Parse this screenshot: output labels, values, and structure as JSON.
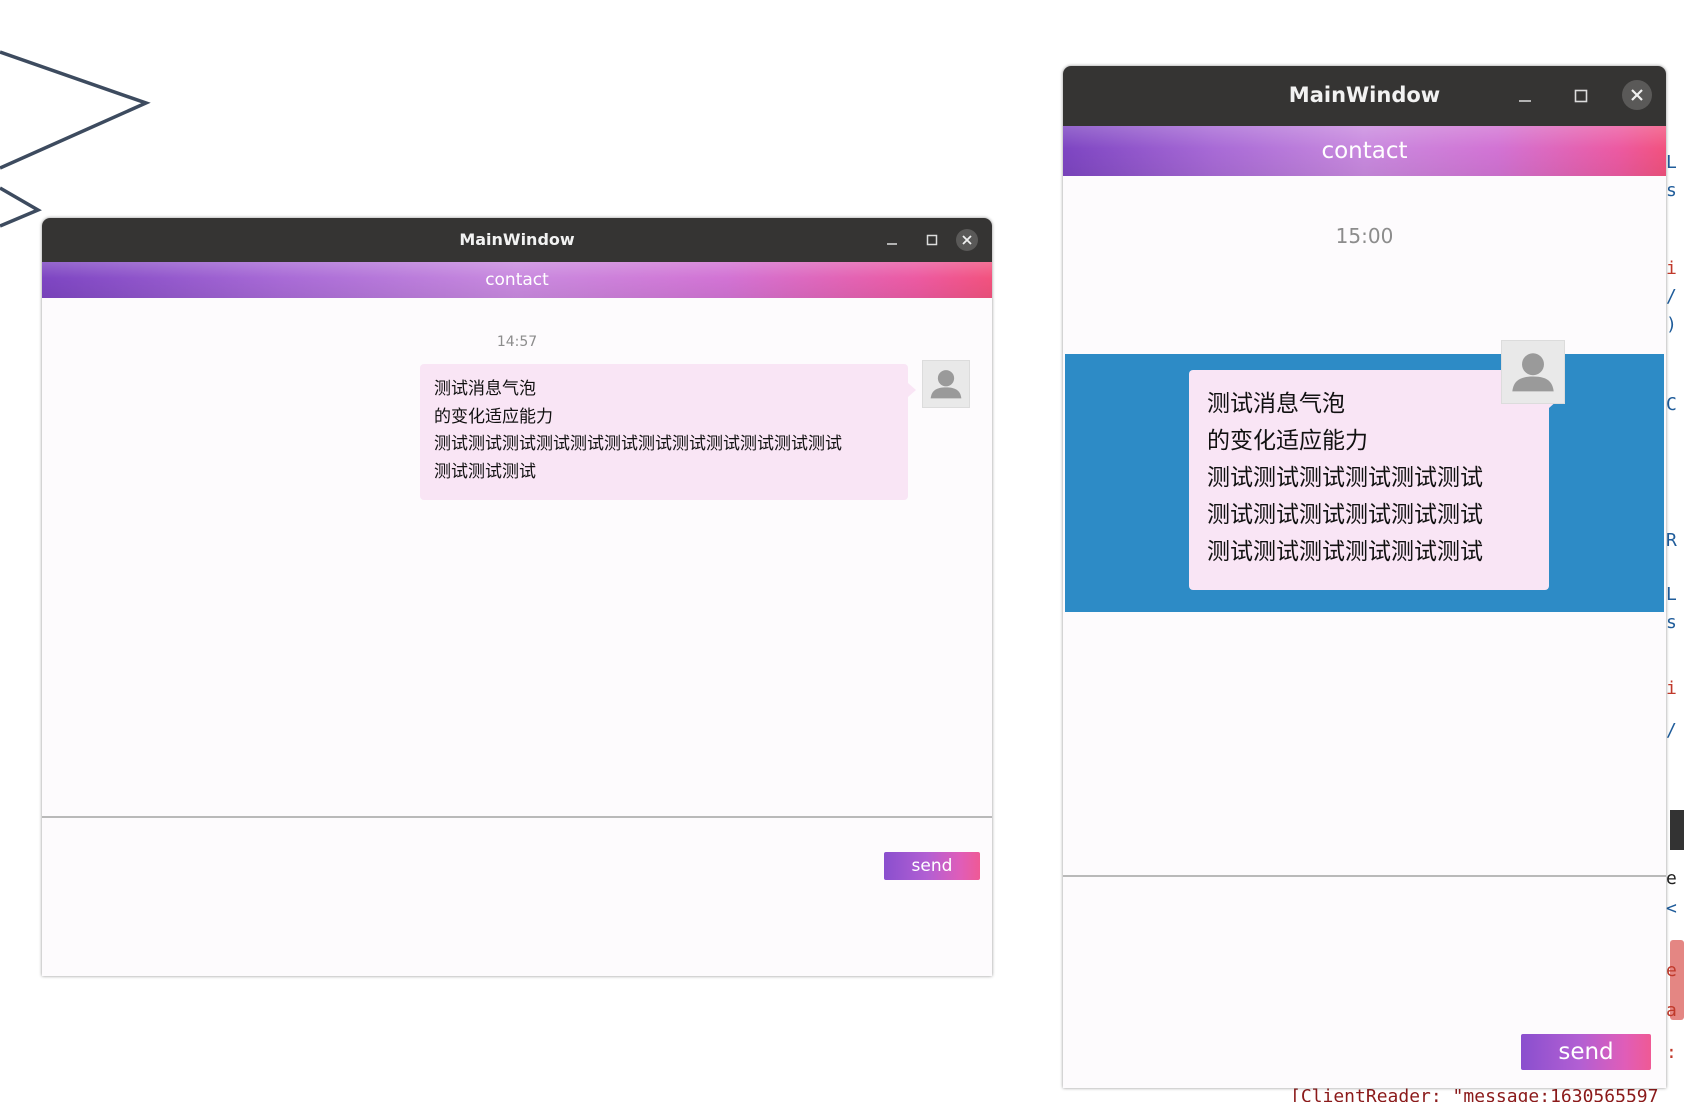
{
  "windows": [
    {
      "title": "MainWindow",
      "contact_label": "contact",
      "time": "14:57",
      "message": "测试消息气泡\n的变化适应能力\n测试测试测试测试测试测试测试测试测试测试测试测试\n测试测试测试",
      "input_value": "",
      "send_label": "send"
    },
    {
      "title": "MainWindow",
      "contact_label": "contact",
      "time": "15:00",
      "message": "测试消息气泡\n的变化适应能力\n测试测试测试测试测试测试\n测试测试测试测试测试测试\n测试测试测试测试测试测试",
      "input_value": "",
      "send_label": "send"
    }
  ],
  "background": {
    "edge_chars": [
      "L",
      "s",
      "i",
      "/",
      ")",
      "C",
      "R",
      "L",
      "s",
      "i",
      "/",
      "e",
      "<",
      "e",
      "a",
      ":"
    ],
    "code_fragment": "[ClientReader:  \"message:1630565597"
  },
  "colors": {
    "titlebar": "#353433",
    "bubble": "#f9e5f5",
    "selected_row": "#2d8bc6",
    "contact_gradient_start": "#7d45c2",
    "contact_gradient_end": "#f2527e"
  },
  "icons": {
    "minimize": "minimize-icon",
    "maximize": "maximize-icon",
    "close": "close-icon",
    "avatar": "user-avatar-icon"
  }
}
